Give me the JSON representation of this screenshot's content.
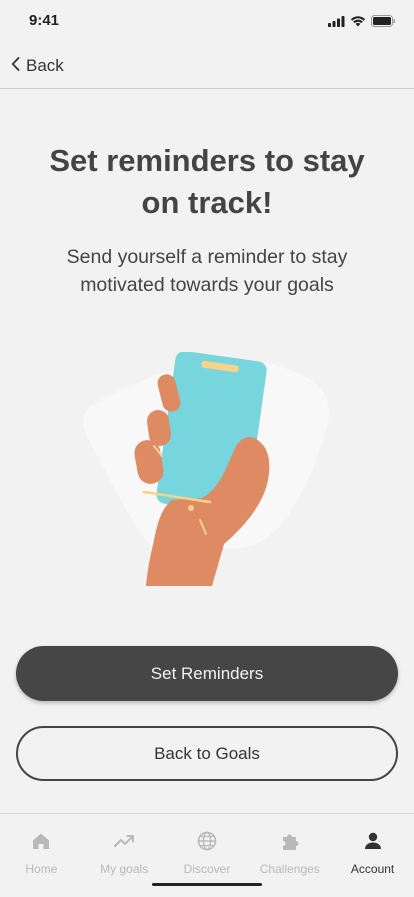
{
  "status_bar": {
    "time": "9:41",
    "icons": [
      "signal-icon",
      "wifi-icon",
      "battery-icon"
    ]
  },
  "nav": {
    "back_label": "Back",
    "back_icon": "chevron-left-icon"
  },
  "main": {
    "title": "Set reminders to stay on track!",
    "subtitle": "Send yourself a reminder to stay motivated towards your goals",
    "illustration": "hand-holding-phone-illustration"
  },
  "buttons": {
    "primary_label": "Set  Reminders",
    "secondary_label": "Back to Goals"
  },
  "tab_bar": {
    "active": "Account",
    "tabs": [
      {
        "label": "Home",
        "icon": "home-icon"
      },
      {
        "label": "My goals",
        "icon": "trend-up-icon"
      },
      {
        "label": "Discover",
        "icon": "globe-icon"
      },
      {
        "label": "Challenges",
        "icon": "puzzle-icon"
      },
      {
        "label": "Account",
        "icon": "person-icon"
      }
    ]
  },
  "colors": {
    "background": "#f2f2f2",
    "primary_button": "#464646",
    "phone": "#76d5dd",
    "skin": "#de8a63",
    "accent_yellow": "#f7d28a",
    "tab_inactive": "#b9b9b9",
    "tab_active": "#333333"
  }
}
